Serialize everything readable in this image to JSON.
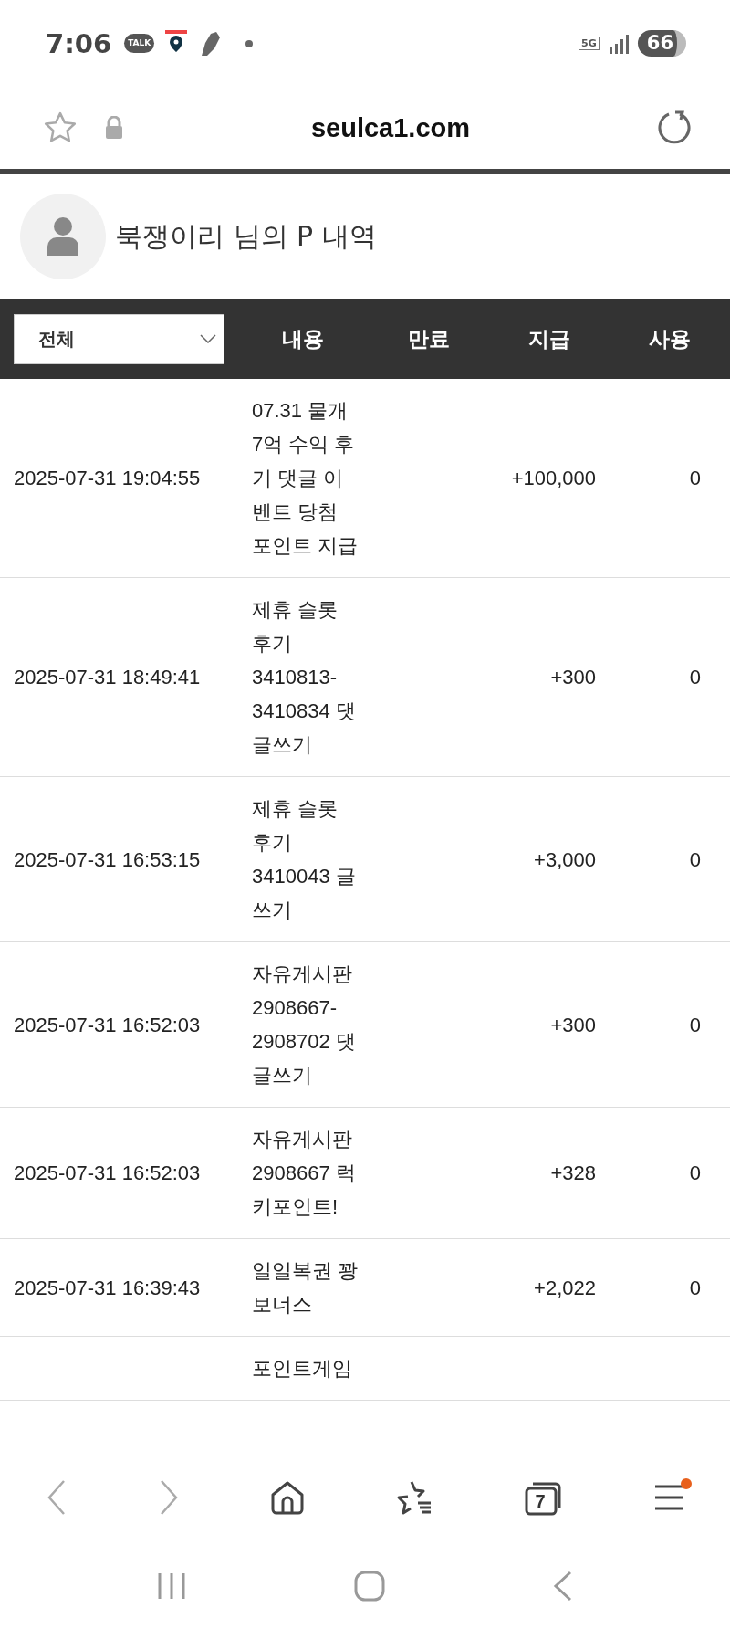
{
  "status_bar": {
    "time": "7:06",
    "chat_badge": "TALK",
    "network": "5G",
    "battery": "66"
  },
  "address_bar": {
    "url": "seulca1.com"
  },
  "profile": {
    "title": "북쟁이리 님의 P 내역"
  },
  "table": {
    "filter": "전체",
    "columns": [
      "내용",
      "만료",
      "지급",
      "사용"
    ],
    "rows": [
      {
        "date": "2025-07-31 19:04:55",
        "content": "07.31 물개 7억 수익 후기 댓글 이벤트 당첨 포인트 지급",
        "expire": "",
        "given": "+100,000",
        "used": "0"
      },
      {
        "date": "2025-07-31 18:49:41",
        "content": "제휴 슬롯 후기 3410813-3410834 댓글쓰기",
        "expire": "",
        "given": "+300",
        "used": "0"
      },
      {
        "date": "2025-07-31 16:53:15",
        "content": "제휴 슬롯 후기 3410043 글쓰기",
        "expire": "",
        "given": "+3,000",
        "used": "0"
      },
      {
        "date": "2025-07-31 16:52:03",
        "content": "자유게시판 2908667-2908702 댓글쓰기",
        "expire": "",
        "given": "+300",
        "used": "0"
      },
      {
        "date": "2025-07-31 16:52:03",
        "content": "자유게시판 2908667 럭키포인트!",
        "expire": "",
        "given": "+328",
        "used": "0"
      },
      {
        "date": "2025-07-31 16:39:43",
        "content": "일일복권 꽝 보너스",
        "expire": "",
        "given": "+2,022",
        "used": "0"
      },
      {
        "date": "",
        "content": "포인트게임",
        "expire": "",
        "given": "",
        "used": ""
      }
    ]
  },
  "bottom_bar": {
    "tab_count": "7",
    "menu_notification": true
  }
}
